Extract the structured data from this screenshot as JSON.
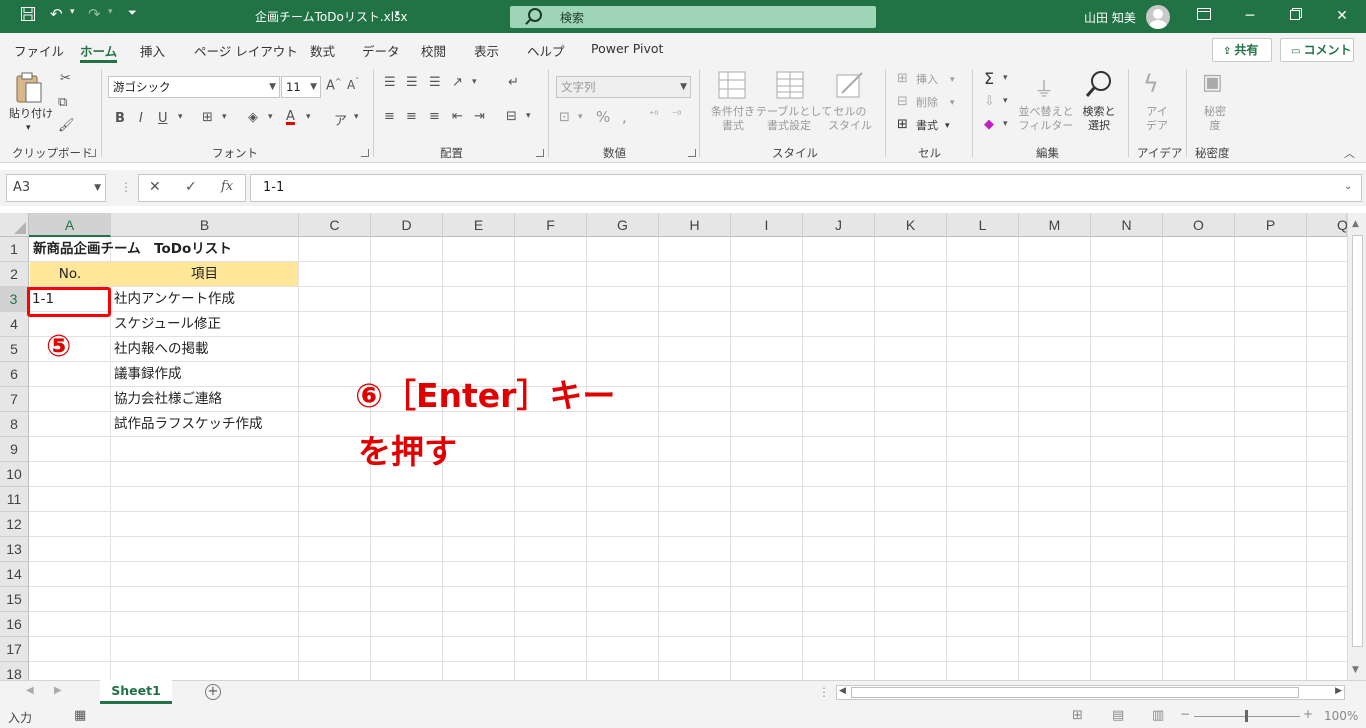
{
  "titlebar": {
    "filename": "企画チームToDoリスト.xlsx",
    "search_placeholder": "検索",
    "user_name": "山田 知美"
  },
  "menu": {
    "tabs": [
      "ファイル",
      "ホーム",
      "挿入",
      "ページ レイアウト",
      "数式",
      "データ",
      "校閲",
      "表示",
      "ヘルプ",
      "Power Pivot"
    ],
    "active_tab": "ホーム",
    "share_label": "共有",
    "comment_label": "コメント"
  },
  "ribbon": {
    "clipboard": {
      "paste_label": "貼り付け",
      "group_label": "クリップボード"
    },
    "font": {
      "font_name": "游ゴシック",
      "font_size": "11",
      "group_label": "フォント"
    },
    "alignment": {
      "group_label": "配置"
    },
    "number": {
      "format": "文字列",
      "group_label": "数値"
    },
    "styles": {
      "conditional": "条件付き\n書式",
      "table": "テーブルとして\n書式設定",
      "cell_styles": "セルの\nスタイル",
      "group_label": "スタイル"
    },
    "cells": {
      "insert": "挿入",
      "delete": "削除",
      "format": "書式",
      "group_label": "セル"
    },
    "editing": {
      "sort": "並べ替えと\nフィルター",
      "find": "検索と\n選択",
      "group_label": "編集"
    },
    "ideas": {
      "label": "アイ\nデア",
      "group_label": "アイデア"
    },
    "sensitivity": {
      "label": "秘密\n度",
      "group_label": "秘密度"
    }
  },
  "formula_bar": {
    "name_box": "A3",
    "cancel": "✕",
    "enter": "✓",
    "fx": "fx",
    "content": "1-1"
  },
  "sheet": {
    "columns": [
      "A",
      "B",
      "C",
      "D",
      "E",
      "F",
      "G",
      "H",
      "I",
      "J",
      "K",
      "L",
      "M",
      "N",
      "O",
      "P",
      "Q"
    ],
    "rows": [
      "1",
      "2",
      "3",
      "4",
      "5",
      "6",
      "7",
      "8",
      "9",
      "10",
      "11",
      "12",
      "13",
      "14",
      "15",
      "16",
      "17",
      "18"
    ],
    "title": "新商品企画チーム　ToDoリスト",
    "header_no": "No.",
    "header_item": "項目",
    "a3_value": "1-1",
    "items": [
      "社内アンケート作成",
      "スケジュール修正",
      "社内報への掲載",
      "議事録作成",
      "協力会社様ご連絡",
      "試作品ラフスケッチ作成"
    ],
    "selected_cell": "A3"
  },
  "annotations": {
    "step5": "⑤",
    "step6_line1": "⑥［Enter］キー",
    "step6_line2": "を押す",
    "accent_color": "#e00000"
  },
  "sheetbar": {
    "sheet_name": "Sheet1",
    "add_symbol": "+"
  },
  "status": {
    "mode": "入力",
    "zoom": "100%"
  }
}
